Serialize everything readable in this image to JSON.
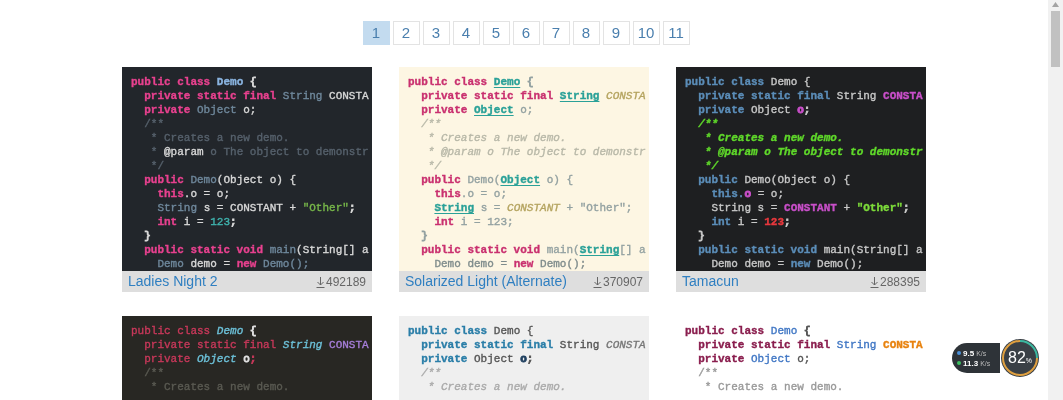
{
  "pagination": [
    {
      "label": "1",
      "selected": true
    },
    {
      "label": "2",
      "selected": false
    },
    {
      "label": "3",
      "selected": false
    },
    {
      "label": "4",
      "selected": false
    },
    {
      "label": "5",
      "selected": false
    },
    {
      "label": "6",
      "selected": false
    },
    {
      "label": "7",
      "selected": false
    },
    {
      "label": "8",
      "selected": false
    },
    {
      "label": "9",
      "selected": false
    },
    {
      "label": "10",
      "selected": false
    },
    {
      "label": "11",
      "selected": false
    }
  ],
  "themes": [
    {
      "color": "#22262b",
      "title": "Ladies Night 2",
      "downloads": "492189",
      "lines": [
        [
          {
            "text": "public class ",
            "color": "#e8418f",
            "kind": "bold"
          },
          {
            "text": "Demo",
            "color": "#8ab4e0",
            "kind": "bold"
          },
          {
            "text": " {",
            "color": "#d8d8d8",
            "kind": "plain"
          }
        ],
        [
          {
            "text": "  private static final ",
            "color": "#e8418f",
            "kind": "bold"
          },
          {
            "text": "String",
            "color": "#6f889c",
            "kind": "plain"
          },
          {
            "text": " CONSTA",
            "color": "#d8d8d8",
            "kind": "plain"
          }
        ],
        [
          {
            "text": "  private ",
            "color": "#e8418f",
            "kind": "bold"
          },
          {
            "text": "Object",
            "color": "#6f889c",
            "kind": "plain"
          },
          {
            "text": " o;",
            "color": "#d8d8d8",
            "kind": "plain"
          }
        ],
        [
          {
            "text": "  /**",
            "color": "#56616c",
            "kind": "plain"
          }
        ],
        [
          {
            "text": "   * Creates a new demo.",
            "color": "#56616c",
            "kind": "plain"
          }
        ],
        [
          {
            "text": "   * ",
            "color": "#56616c",
            "kind": "plain"
          },
          {
            "text": "@param",
            "color": "#d8d8d8",
            "kind": "plain"
          },
          {
            "text": " o The object to demonstr",
            "color": "#56616c",
            "kind": "plain"
          }
        ],
        [
          {
            "text": "   */",
            "color": "#56616c",
            "kind": "plain"
          }
        ],
        [
          {
            "text": "  public ",
            "color": "#e8418f",
            "kind": "bold"
          },
          {
            "text": "Demo",
            "color": "#6f889c",
            "kind": "plain"
          },
          {
            "text": "(Object o) {",
            "color": "#d8d8d8",
            "kind": "plain"
          }
        ],
        [
          {
            "text": "    this",
            "color": "#e8418f",
            "kind": "bold"
          },
          {
            "text": ".o = o;",
            "color": "#d8d8d8",
            "kind": "plain"
          }
        ],
        [
          {
            "text": "    String",
            "color": "#6f889c",
            "kind": "plain"
          },
          {
            "text": " s = CONSTANT + ",
            "color": "#d8d8d8",
            "kind": "plain"
          },
          {
            "text": "\"Other\"",
            "color": "#78b84a",
            "kind": "plain"
          },
          {
            "text": ";",
            "color": "#d8d8d8",
            "kind": "plain"
          }
        ],
        [
          {
            "text": "    int",
            "color": "#e8418f",
            "kind": "bold"
          },
          {
            "text": " i = ",
            "color": "#d8d8d8",
            "kind": "plain"
          },
          {
            "text": "123",
            "color": "#3fb3ae",
            "kind": "plain"
          },
          {
            "text": ";",
            "color": "#d8d8d8",
            "kind": "plain"
          }
        ],
        [
          {
            "text": "  }",
            "color": "#d8d8d8",
            "kind": "plain"
          }
        ],
        [
          {
            "text": "  public static void ",
            "color": "#e8418f",
            "kind": "bold"
          },
          {
            "text": "main",
            "color": "#6f889c",
            "kind": "plain"
          },
          {
            "text": "(String[] a",
            "color": "#d8d8d8",
            "kind": "plain"
          }
        ],
        [
          {
            "text": "    Demo",
            "color": "#6f889c",
            "kind": "plain"
          },
          {
            "text": " demo = ",
            "color": "#d8d8d8",
            "kind": "plain"
          },
          {
            "text": "new",
            "color": "#e8418f",
            "kind": "bold"
          },
          {
            "text": " Demo();",
            "color": "#6f889c",
            "kind": "plain"
          }
        ]
      ]
    },
    {
      "color": "#fdf6e3",
      "title": "Solarized Light (Alternate)",
      "downloads": "370907",
      "lines": [
        [
          {
            "text": "public class ",
            "color": "#c9306f",
            "kind": "bold"
          },
          {
            "text": "Demo",
            "color": "#2aa198",
            "kind": "underline"
          },
          {
            "text": " {",
            "color": "#93a1a1",
            "kind": "plain"
          }
        ],
        [
          {
            "text": "  private static final ",
            "color": "#c9306f",
            "kind": "bold"
          },
          {
            "text": "String",
            "color": "#2aa198",
            "kind": "underline"
          },
          {
            "text": " CONSTA",
            "color": "#b5a460",
            "kind": "italic"
          }
        ],
        [
          {
            "text": "  private ",
            "color": "#c9306f",
            "kind": "bold"
          },
          {
            "text": "Object",
            "color": "#2aa198",
            "kind": "underline"
          },
          {
            "text": " o;",
            "color": "#93a1a1",
            "kind": "plain"
          }
        ],
        [
          {
            "text": "  /**",
            "color": "#b8b8a8",
            "kind": "italic"
          }
        ],
        [
          {
            "text": "   * Creates a new demo.",
            "color": "#b8b8a8",
            "kind": "italic"
          }
        ],
        [
          {
            "text": "   * @param o The object to demonstr",
            "color": "#b8b8a8",
            "kind": "italic"
          }
        ],
        [
          {
            "text": "   */",
            "color": "#b8b8a8",
            "kind": "italic"
          }
        ],
        [
          {
            "text": "  public ",
            "color": "#c9306f",
            "kind": "bold"
          },
          {
            "text": "Demo(",
            "color": "#93a1a1",
            "kind": "plain"
          },
          {
            "text": "Object",
            "color": "#2aa198",
            "kind": "underline"
          },
          {
            "text": " o) {",
            "color": "#93a1a1",
            "kind": "plain"
          }
        ],
        [
          {
            "text": "    this",
            "color": "#c9306f",
            "kind": "bold"
          },
          {
            "text": ".o = o;",
            "color": "#93a1a1",
            "kind": "plain"
          }
        ],
        [
          {
            "text": "    String",
            "color": "#2aa198",
            "kind": "underline"
          },
          {
            "text": " s = ",
            "color": "#93a1a1",
            "kind": "plain"
          },
          {
            "text": "CONSTANT",
            "color": "#b5a460",
            "kind": "italic"
          },
          {
            "text": " + \"Other\";",
            "color": "#93a1a1",
            "kind": "plain"
          }
        ],
        [
          {
            "text": "    int",
            "color": "#c9306f",
            "kind": "bold"
          },
          {
            "text": " i = 123;",
            "color": "#93a1a1",
            "kind": "plain"
          }
        ],
        [
          {
            "text": "  }",
            "color": "#93a1a1",
            "kind": "plain"
          }
        ],
        [
          {
            "text": "  public static void ",
            "color": "#c9306f",
            "kind": "bold"
          },
          {
            "text": "main(",
            "color": "#93a1a1",
            "kind": "plain"
          },
          {
            "text": "String",
            "color": "#2aa198",
            "kind": "underline"
          },
          {
            "text": "[] a",
            "color": "#93a1a1",
            "kind": "plain"
          }
        ],
        [
          {
            "text": "    Demo demo = ",
            "color": "#7f8c8c",
            "kind": "plain"
          },
          {
            "text": "new",
            "color": "#c9306f",
            "kind": "bold"
          },
          {
            "text": " Demo();",
            "color": "#7f8c8c",
            "kind": "plain"
          }
        ]
      ]
    },
    {
      "color": "#1e1f21",
      "title": "Tamacun",
      "downloads": "288395",
      "lines": [
        [
          {
            "text": "public class ",
            "color": "#5b8db8",
            "kind": "bold"
          },
          {
            "text": "Demo {",
            "color": "#c8c8c8",
            "kind": "plain"
          }
        ],
        [
          {
            "text": "  private static final ",
            "color": "#5b8db8",
            "kind": "bold"
          },
          {
            "text": "String ",
            "color": "#c8c8c8",
            "kind": "plain"
          },
          {
            "text": "CONSTA",
            "color": "#c94fc9",
            "kind": "bold"
          }
        ],
        [
          {
            "text": "  private ",
            "color": "#5b8db8",
            "kind": "bold"
          },
          {
            "text": "Object ",
            "color": "#c8c8c8",
            "kind": "plain"
          },
          {
            "text": "o",
            "color": "#c94fc9",
            "kind": "bold"
          },
          {
            "text": ";",
            "color": "#c8c8c8",
            "kind": "plain"
          }
        ],
        [
          {
            "text": "  /**",
            "color": "#5fd82a",
            "kind": "bold-italic"
          }
        ],
        [
          {
            "text": "   * Creates a new demo.",
            "color": "#5fd82a",
            "kind": "bold-italic"
          }
        ],
        [
          {
            "text": "   * @param o The object to demonstr",
            "color": "#5fd82a",
            "kind": "bold-italic"
          }
        ],
        [
          {
            "text": "   */",
            "color": "#5fd82a",
            "kind": "bold-italic"
          }
        ],
        [
          {
            "text": "  public ",
            "color": "#5b8db8",
            "kind": "bold"
          },
          {
            "text": "Demo(Object o) {",
            "color": "#c8c8c8",
            "kind": "plain"
          }
        ],
        [
          {
            "text": "    this.",
            "color": "#5b8db8",
            "kind": "bold"
          },
          {
            "text": "o",
            "color": "#c94fc9",
            "kind": "bold"
          },
          {
            "text": " = o;",
            "color": "#c8c8c8",
            "kind": "plain"
          }
        ],
        [
          {
            "text": "    String s = ",
            "color": "#c8c8c8",
            "kind": "plain"
          },
          {
            "text": "CONSTANT",
            "color": "#c94fc9",
            "kind": "bold"
          },
          {
            "text": " + ",
            "color": "#c8c8c8",
            "kind": "plain"
          },
          {
            "text": "\"Other\"",
            "color": "#7ddc3a",
            "kind": "bold"
          },
          {
            "text": ";",
            "color": "#c8c8c8",
            "kind": "plain"
          }
        ],
        [
          {
            "text": "    int",
            "color": "#5b8db8",
            "kind": "bold"
          },
          {
            "text": " i = ",
            "color": "#c8c8c8",
            "kind": "plain"
          },
          {
            "text": "123",
            "color": "#e8383d",
            "kind": "bold"
          },
          {
            "text": ";",
            "color": "#c8c8c8",
            "kind": "plain"
          }
        ],
        [
          {
            "text": "  }",
            "color": "#c8c8c8",
            "kind": "plain"
          }
        ],
        [
          {
            "text": "  public static void ",
            "color": "#5b8db8",
            "kind": "bold"
          },
          {
            "text": "main(String[] a",
            "color": "#c8c8c8",
            "kind": "plain"
          }
        ],
        [
          {
            "text": "    Demo demo = ",
            "color": "#c8c8c8",
            "kind": "plain"
          },
          {
            "text": "new",
            "color": "#5b8db8",
            "kind": "bold"
          },
          {
            "text": " Demo();",
            "color": "#c8c8c8",
            "kind": "plain"
          }
        ]
      ]
    },
    {
      "color": "#282723",
      "lines": [
        [
          {
            "text": "public class ",
            "color": "#c8385a",
            "kind": "plain"
          },
          {
            "text": "Demo",
            "color": "#6cc0d8",
            "kind": "italic"
          },
          {
            "text": " {",
            "color": "#e0e0e0",
            "kind": "plain"
          }
        ],
        [
          {
            "text": "  private static final ",
            "color": "#c8385a",
            "kind": "plain"
          },
          {
            "text": "String",
            "color": "#6cc0d8",
            "kind": "italic"
          },
          {
            "text": " CONSTA",
            "color": "#a67ed9",
            "kind": "plain"
          }
        ],
        [
          {
            "text": "  private ",
            "color": "#c8385a",
            "kind": "plain"
          },
          {
            "text": "Object",
            "color": "#6cc0d8",
            "kind": "italic"
          },
          {
            "text": " o",
            "color": "#e0e0e0",
            "kind": "plain"
          },
          {
            "text": ";",
            "color": "#c8385a",
            "kind": "plain"
          }
        ],
        [
          {
            "text": "  /**",
            "color": "#5a5a52",
            "kind": "plain"
          }
        ],
        [
          {
            "text": "   * Creates a new demo.",
            "color": "#5a5a52",
            "kind": "plain"
          }
        ]
      ]
    },
    {
      "color": "#efefef",
      "lines": [
        [
          {
            "text": "public class ",
            "color": "#2a7ea8",
            "kind": "bold"
          },
          {
            "text": "Demo {",
            "color": "#555555",
            "kind": "plain"
          }
        ],
        [
          {
            "text": "  private static final ",
            "color": "#2a7ea8",
            "kind": "bold"
          },
          {
            "text": "String ",
            "color": "#555555",
            "kind": "plain"
          },
          {
            "text": "CONSTA",
            "color": "#777777",
            "kind": "italic"
          }
        ],
        [
          {
            "text": "  private ",
            "color": "#2a7ea8",
            "kind": "bold"
          },
          {
            "text": "Object ",
            "color": "#555555",
            "kind": "plain"
          },
          {
            "text": "o",
            "color": "#1f3f5f",
            "kind": "bold"
          },
          {
            "text": ";",
            "color": "#555555",
            "kind": "plain"
          }
        ],
        [
          {
            "text": "  /**",
            "color": "#aaaaaa",
            "kind": "italic"
          }
        ],
        [
          {
            "text": "   * Creates a new demo.",
            "color": "#aaaaaa",
            "kind": "italic"
          }
        ]
      ]
    },
    {
      "color": "#ffffff",
      "lines": [
        [
          {
            "text": "public class ",
            "color": "#8a1e4e",
            "kind": "bold"
          },
          {
            "text": "Demo",
            "color": "#3f76c4",
            "kind": "plain"
          },
          {
            "text": " {",
            "color": "#555555",
            "kind": "plain"
          }
        ],
        [
          {
            "text": "  private static final ",
            "color": "#8a1e4e",
            "kind": "bold"
          },
          {
            "text": "String",
            "color": "#3f76c4",
            "kind": "plain"
          },
          {
            "text": " CONSTA",
            "color": "#e8820e",
            "kind": "bold"
          }
        ],
        [
          {
            "text": "  private ",
            "color": "#8a1e4e",
            "kind": "bold"
          },
          {
            "text": "Object",
            "color": "#3f76c4",
            "kind": "plain"
          },
          {
            "text": " o;",
            "color": "#555555",
            "kind": "plain"
          }
        ],
        [
          {
            "text": "  /**",
            "color": "#999999",
            "kind": "plain"
          }
        ],
        [
          {
            "text": "   * Creates a new demo.",
            "color": "#999999",
            "kind": "plain"
          }
        ]
      ]
    }
  ],
  "speed_widget": {
    "speeds": [
      {
        "value": "9.5",
        "unit": "K/s",
        "color": "#4a90d9"
      },
      {
        "value": "11.3",
        "unit": "K/s",
        "color": "#3cc060"
      }
    ],
    "percent": "82",
    "percent_unit": "%"
  }
}
